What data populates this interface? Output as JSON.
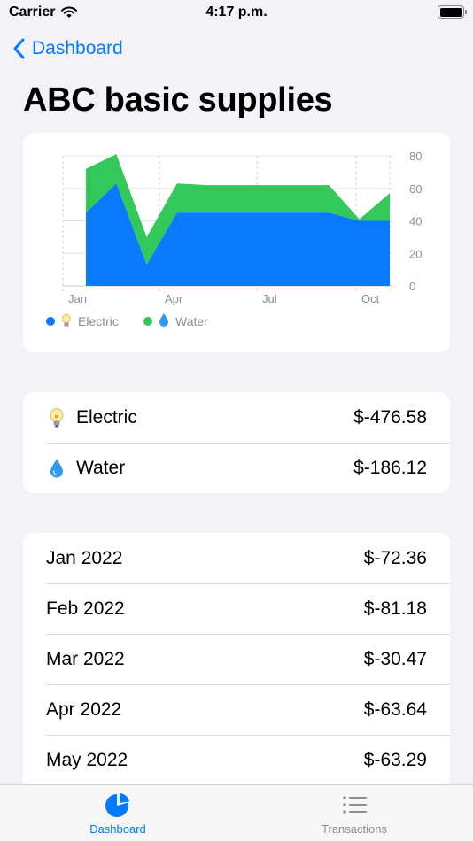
{
  "status_bar": {
    "carrier": "Carrier",
    "time": "4:17 p.m."
  },
  "nav": {
    "back_label": "Dashboard"
  },
  "page": {
    "title": "ABC basic supplies"
  },
  "colors": {
    "accent": "#007aff",
    "electric": "#0a7aff",
    "water": "#34c759"
  },
  "chart_data": {
    "type": "area",
    "stacked": true,
    "x": [
      "Jan 2022",
      "Feb 2022",
      "Mar 2022",
      "Apr 2022",
      "May 2022",
      "Jun 2022",
      "Jul 2022",
      "Aug 2022",
      "Sep 2022",
      "Oct 2022",
      "Nov 2022"
    ],
    "x_tick_labels": [
      "Jan",
      "Apr",
      "Jul",
      "Oct"
    ],
    "y_ticks": [
      0,
      20,
      40,
      60,
      80
    ],
    "ylim": [
      0,
      80
    ],
    "y_axis_position": "right",
    "grid": true,
    "series": [
      {
        "name": "Electric",
        "icon": "lightbulb-icon",
        "color": "#0a7aff",
        "values": [
          45,
          63,
          13,
          45,
          45,
          45,
          45,
          45,
          45,
          40,
          40
        ]
      },
      {
        "name": "Water",
        "icon": "water-drop-icon",
        "color": "#34c759",
        "values": [
          27,
          18,
          17,
          18,
          17,
          17,
          17,
          17,
          17,
          1,
          17
        ]
      }
    ],
    "legend_position": "bottom-left"
  },
  "summary": [
    {
      "icon": "lightbulb-icon",
      "label": "Electric",
      "value": "$-476.58"
    },
    {
      "icon": "water-drop-icon",
      "label": "Water",
      "value": "$-186.12"
    }
  ],
  "months": [
    {
      "label": "Jan 2022",
      "value": "$-72.36"
    },
    {
      "label": "Feb 2022",
      "value": "$-81.18"
    },
    {
      "label": "Mar 2022",
      "value": "$-30.47"
    },
    {
      "label": "Apr 2022",
      "value": "$-63.64"
    },
    {
      "label": "May 2022",
      "value": "$-63.29"
    }
  ],
  "tabs": [
    {
      "label": "Dashboard",
      "icon": "pie-chart-icon",
      "selected": true
    },
    {
      "label": "Transactions",
      "icon": "list-icon",
      "selected": false
    }
  ]
}
